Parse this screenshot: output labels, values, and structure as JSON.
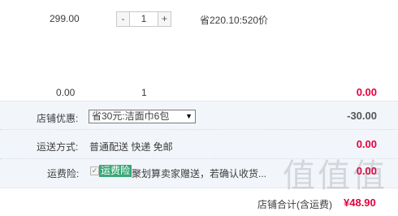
{
  "item": {
    "price": "299.00",
    "quantity": "1",
    "stepper": {
      "minus_label": "-",
      "plus_label": "+"
    },
    "note": "省220.10:520价"
  },
  "summary_row": {
    "price": "0.00",
    "quantity": "1",
    "amount": "0.00"
  },
  "shop_discount": {
    "label": "店铺优惠:",
    "selected": "省30元:洁面巾6包",
    "amount": "-30.00"
  },
  "shipping": {
    "label": "运送方式:",
    "value": "普通配送 快递 免邮",
    "amount": "0.00"
  },
  "insurance": {
    "label": "运费险:",
    "checked": true,
    "badge": "运费险",
    "text": "聚划算卖家赠送，若确认收货...",
    "amount": "0.00"
  },
  "total": {
    "label": "店铺合计(含运费)",
    "amount": "¥48.90"
  },
  "watermark": "值值值",
  "colors": {
    "price_red": "#e6003c",
    "band_bg": "#f2f6fb",
    "badge_green": "#3aa876"
  },
  "icons": {
    "select_arrow": "triangle-down-icon",
    "checkbox": "checkmark-icon"
  }
}
